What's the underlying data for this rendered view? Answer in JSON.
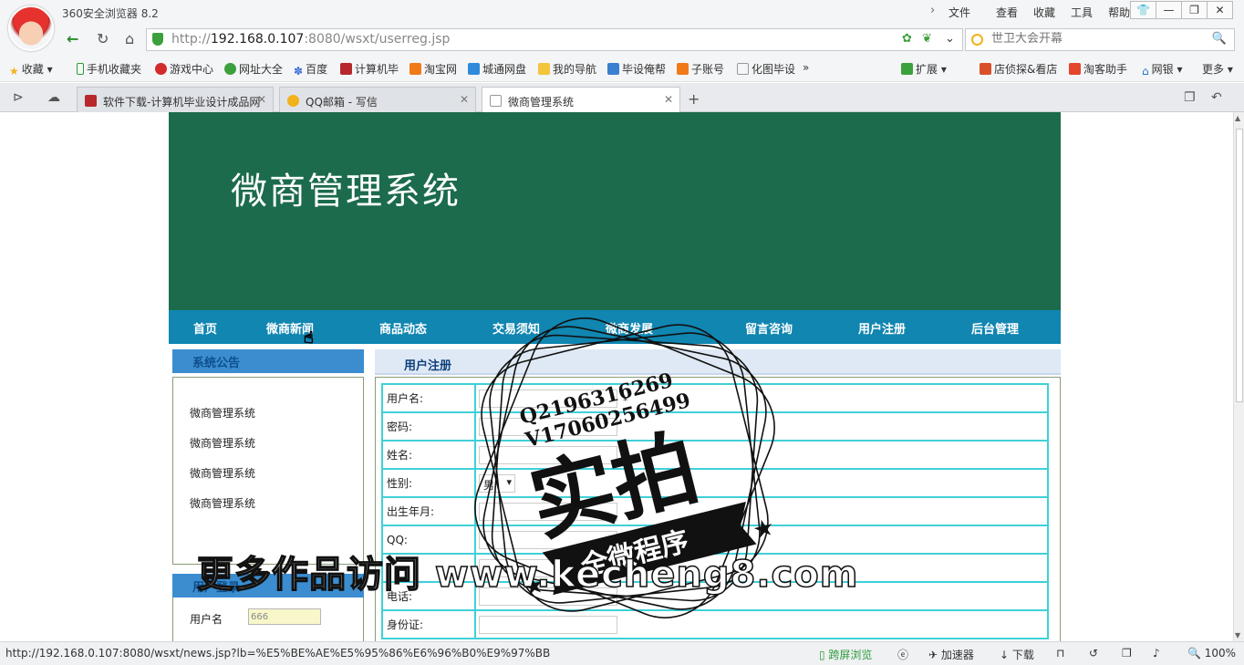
{
  "app": {
    "title": "360安全浏览器 8.2",
    "menu": [
      "文件",
      "查看",
      "收藏",
      "工具",
      "帮助"
    ]
  },
  "address": {
    "url_gray_prefix": "http://",
    "url_host": "192.168.0.107",
    "url_rest": ":8080/wsxt/userreg.jsp",
    "search_placeholder": "世卫大会开幕"
  },
  "favorites": {
    "left": [
      "收藏",
      "手机收藏夹",
      "游戏中心",
      "网址大全",
      "百度",
      "计算机毕",
      "淘宝网",
      "城通网盘",
      "我的导航",
      "毕设俺帮",
      "子账号",
      "化图毕设"
    ],
    "more_chevron": "»",
    "right": [
      "扩展",
      "店侦探&看店",
      "淘客助手",
      "网银",
      "更多"
    ]
  },
  "tabs": [
    {
      "label": "软件下载-计算机毕业设计成品网"
    },
    {
      "label": "QQ邮箱 - 写信"
    },
    {
      "label": "微商管理系统"
    }
  ],
  "site": {
    "title": "微商管理系统",
    "nav": [
      "首页",
      "微商新闻",
      "商品动态",
      "交易须知",
      "微商发展",
      "留言咨询",
      "用户注册",
      "后台管理"
    ],
    "sidebar": {
      "notice_title": "系统公告",
      "notices": [
        "微商管理系统",
        "微商管理系统",
        "微商管理系统",
        "微商管理系统"
      ],
      "login_title": "用户登录",
      "login_label": "用户名",
      "login_value": "666"
    },
    "content_title": "用户注册",
    "form": {
      "rows": [
        {
          "label": "用户名:",
          "type": "text",
          "required": "*"
        },
        {
          "label": "密码:",
          "type": "text",
          "required": ""
        },
        {
          "label": "姓名:",
          "type": "text",
          "required": "*"
        },
        {
          "label": "性别:",
          "type": "select",
          "value": "男"
        },
        {
          "label": "出生年月:",
          "type": "text",
          "required": ""
        },
        {
          "label": "QQ:",
          "type": "text",
          "required": ""
        },
        {
          "label": "",
          "type": "text",
          "required": ""
        },
        {
          "label": "电话:",
          "type": "text",
          "required": ""
        },
        {
          "label": "身份证:",
          "type": "text",
          "required": ""
        }
      ]
    }
  },
  "watermark": {
    "contact_q": "Q2196316269",
    "contact_v": "V17060256499",
    "big_text": "实拍",
    "ribbon_text": "全微程序",
    "caption": "更多作品访问 www.kecheng8.com"
  },
  "status": {
    "url": "http://192.168.0.107:8080/wsxt/news.jsp?lb=%E5%BE%AE%E5%95%86%E6%96%B0%E9%97%BB",
    "cross_screen": "跨屏浏览",
    "accelerator": "加速器",
    "download": "下载",
    "zoom": "100%"
  },
  "colors": {
    "banner": "#1b6b4c",
    "navbar": "#1086b1",
    "table_border": "#3fd0d8",
    "side_head": "#3b8dd0"
  }
}
